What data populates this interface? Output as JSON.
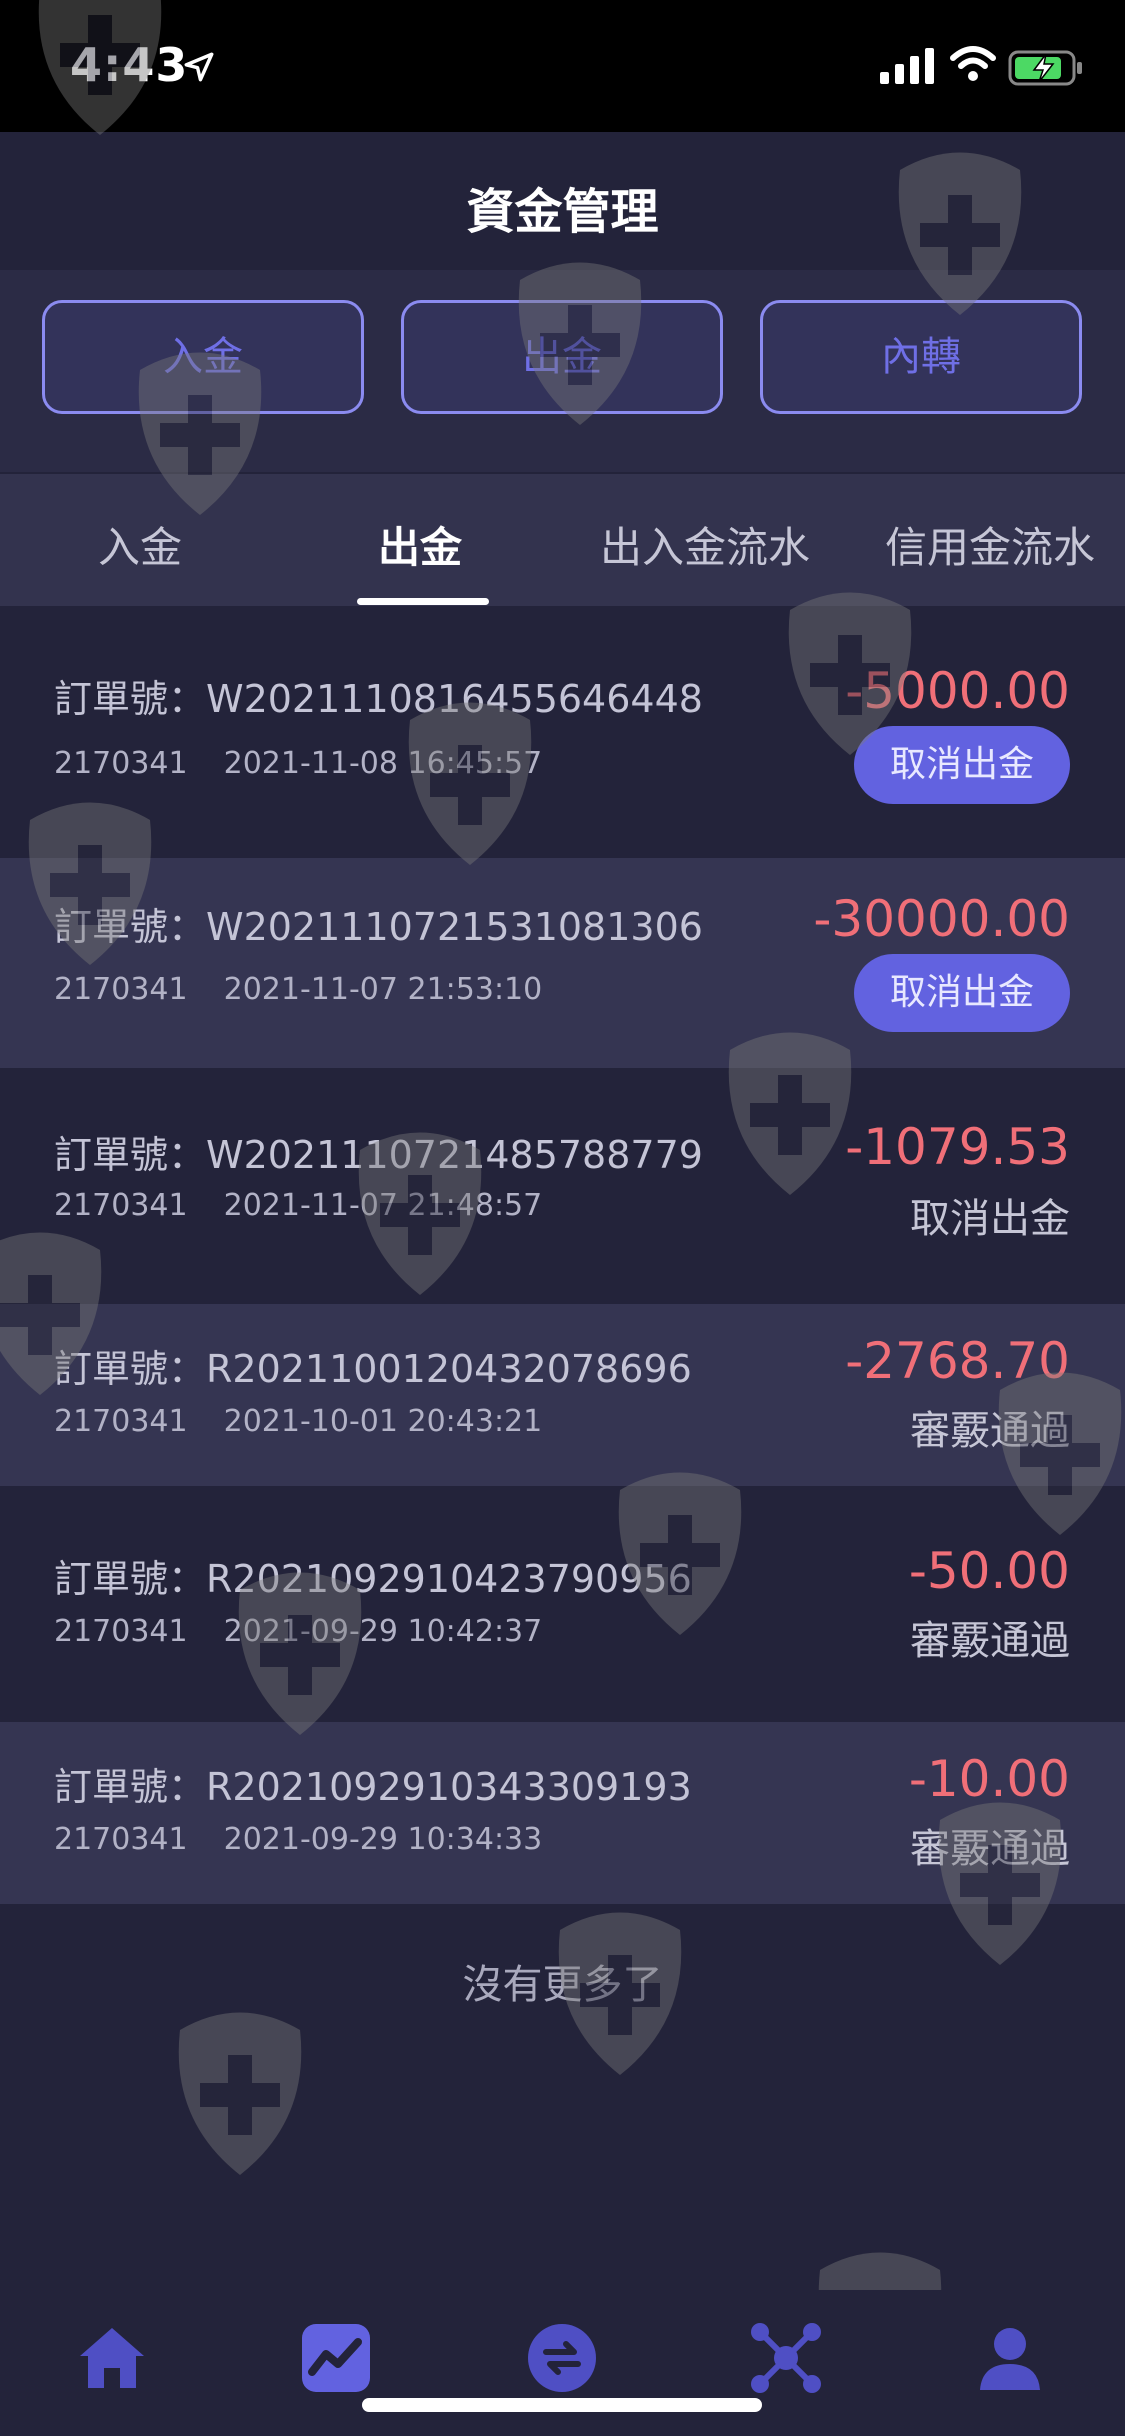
{
  "status_bar": {
    "time": "4:43"
  },
  "header": {
    "title": "資金管理"
  },
  "actions": [
    {
      "label": "入金"
    },
    {
      "label": "出金"
    },
    {
      "label": "內轉"
    }
  ],
  "tabs": [
    {
      "label": "入金"
    },
    {
      "label": "出金",
      "active": true
    },
    {
      "label": "出入金流水"
    },
    {
      "label": "信用金流水"
    }
  ],
  "transactions": [
    {
      "order": "訂單號：W2021110816455646448",
      "account": "2170341",
      "date": "2021-11-08 16:45:57",
      "amount": "-5000.00",
      "action": "取消出金"
    },
    {
      "order": "訂單號：W2021110721531081306",
      "account": "2170341",
      "date": "2021-11-07 21:53:10",
      "amount": "-30000.00",
      "action": "取消出金"
    },
    {
      "order": "訂單號：W2021110721485788779",
      "account": "2170341",
      "date": "2021-11-07 21:48:57",
      "amount": "-1079.53",
      "status": "取消出金"
    },
    {
      "order": "訂單號：R2021100120432078696",
      "account": "2170341",
      "date": "2021-10-01 20:43:21",
      "amount": "-2768.70",
      "status": "審覈通過"
    },
    {
      "order": "訂單號：R2021092910423790956",
      "account": "2170341",
      "date": "2021-09-29 10:42:37",
      "amount": "-50.00",
      "status": "審覈通過"
    },
    {
      "order": "訂單號：R2021092910343309193",
      "account": "2170341",
      "date": "2021-09-29 10:34:33",
      "amount": "-10.00",
      "status": "審覈通過"
    }
  ],
  "footer_text": "沒有更多了",
  "bottom_nav": [
    {
      "icon": "home-icon"
    },
    {
      "icon": "chart-icon",
      "active": true
    },
    {
      "icon": "transfer-icon"
    },
    {
      "icon": "network-icon"
    },
    {
      "icon": "user-icon"
    }
  ],
  "colors": {
    "background": "#23233a",
    "accent": "#6262e0",
    "negative_amount": "#f06f78",
    "nav_icon": "#4f4fc4"
  }
}
